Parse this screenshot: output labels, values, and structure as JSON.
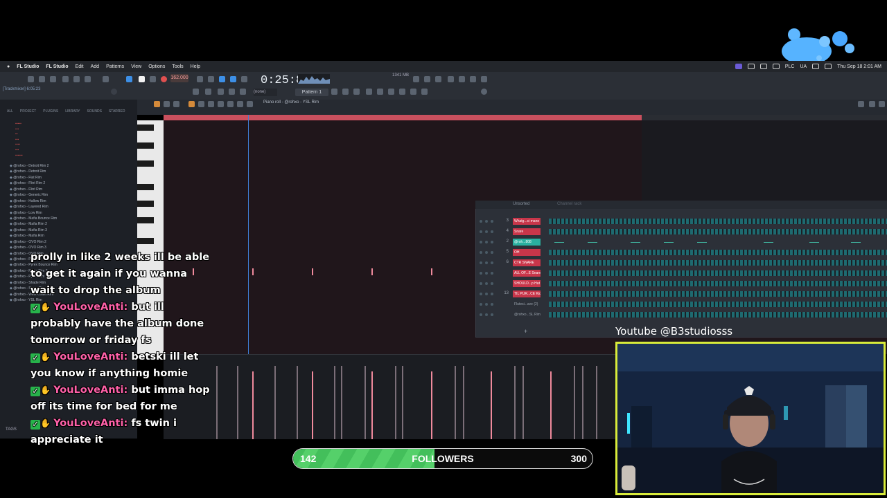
{
  "menubar": {
    "items": [
      "FL Studio",
      "FL Studio",
      "Edit",
      "Add",
      "Patterns",
      "View",
      "Options",
      "Tools",
      "Help"
    ],
    "plc": "PLC",
    "locale": "UA",
    "clock": "Thu Sep 18  2:01 AM"
  },
  "toolbar": {
    "time": "0:25:81",
    "tempo": "162.000",
    "pattern": "Pattern 1",
    "none_box": "(none)",
    "song_info": "[Trackmixer]\n6:05:23",
    "mem": "1341 MB"
  },
  "browser": {
    "tabs": [
      "ALL",
      "PROJECT",
      "PLUGINS",
      "LIBRARY",
      "SOUNDS",
      "STARRED"
    ],
    "items": [
      "@rohxo - Detroit Rim 2",
      "@rohxo - Detroit Rim",
      "@rohxo - Flat Rim",
      "@rohxo - Flint Rim 2",
      "@rohxo - Flint Rim",
      "@rohxo - Generic Rim",
      "@rohxo - Hallow Rim",
      "@rohxo - Layered Rim",
      "@rohxo - Low Rim",
      "@rohxo - Mafia Bounce Rim",
      "@rohxo - Mafia Rim 2",
      "@rohxo - Mafia Rim 3",
      "@rohxo - Mafia Rim",
      "@rohxo - OVO Rim 2",
      "@rohxo - OVO Rim 3",
      "@rohxo - OVO Rim",
      "@rohxo - Pill Rim",
      "@rohxo - Pyrex Bounce Rim",
      "@rohxo - Pyrex Rim 2",
      "@rohxo - Pyrex Rim",
      "@rohxo - Shade Rim",
      "@rohxo - Snare Rim",
      "@rohxo - West Coast Rim",
      "@rohxo - YSL Rim"
    ],
    "tags": "TAGS"
  },
  "piano_roll": {
    "title": "Piano roll - @rohxo - YSL Rim"
  },
  "channel_rack": {
    "filter": "Unsorted",
    "title": "Channel rack",
    "channels": [
      {
        "num": "3",
        "name": "Whatg...ci mane",
        "color": "#c9364a"
      },
      {
        "num": "4",
        "name": "Snare",
        "color": "#c9364a"
      },
      {
        "num": "2",
        "name": "@roh...808",
        "color": "#2ab0a0"
      },
      {
        "num": "5",
        "name": "OH",
        "color": "#c9364a"
      },
      {
        "num": "6",
        "name": "CTR SNARE",
        "color": "#c9364a"
      },
      {
        "num": "",
        "name": "ALL OF...E Snare",
        "color": "#c9364a"
      },
      {
        "num": "",
        "name": "SHOULD...p Hat",
        "color": "#c9364a"
      },
      {
        "num": "13",
        "name": "TIL PUR...CE Kick",
        "color": "#c9364a"
      },
      {
        "num": "",
        "name": "Flutesi...ave (2)",
        "color": "#2c3038"
      },
      {
        "num": "",
        "name": "@rohxo...SL Rim",
        "color": "#2c3038"
      }
    ]
  },
  "chat": {
    "messages": [
      {
        "user": "",
        "text": "prolly in like 2 weeks ill be able to get it again if you wanna wait to drop the album"
      },
      {
        "user": "YouLoveAnti:",
        "text": "but ill probably have the album done tomorrow or friday fs"
      },
      {
        "user": "YouLoveAnti:",
        "text": "betski ill let you know if anything homie"
      },
      {
        "user": "YouLoveAnti:",
        "text": "but imma hop off its time for bed for me"
      },
      {
        "user": "YouLoveAnti:",
        "text": "fs twin i appreciate it"
      }
    ]
  },
  "followers": {
    "current": "142",
    "label": "FOLLOWERS",
    "goal": "300",
    "progress": 0.473
  },
  "webcam": {
    "youtube": "Youtube @B3studiosss"
  }
}
